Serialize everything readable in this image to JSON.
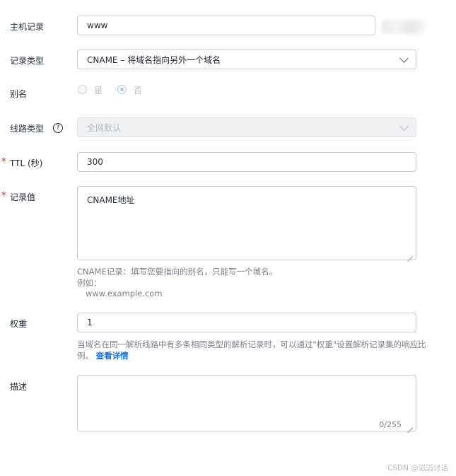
{
  "fields": {
    "host": {
      "label": "主机记录",
      "value": "www"
    },
    "record_type": {
      "label": "记录类型",
      "value": "CNAME – 将域名指向另外一个域名"
    },
    "alias": {
      "label": "别名",
      "options": [
        "是",
        "否"
      ],
      "selected": "否"
    },
    "line_type": {
      "label": "线路类型",
      "help": "?",
      "value": "全网默认"
    },
    "ttl": {
      "required_mark": "*",
      "label": "TTL (秒)",
      "value": "300"
    },
    "record_value": {
      "required_mark": "*",
      "label": "记录值",
      "value": "CNAME地址",
      "hint_line1": "CNAME记录：填写您要指向的别名，只能写一个域名。",
      "hint_line2": "例如：",
      "hint_line3": "www.example.com"
    },
    "weight": {
      "label": "权重",
      "value": "1",
      "hint_line1": "当域名在同一解析线路中有多条相同类型的解析记录时，可以通过\"权重\"设置解析记录集的响应比",
      "hint_line2": "例。",
      "link": "查看详情"
    },
    "description": {
      "label": "描述",
      "value": "",
      "counter": "0/255"
    }
  },
  "watermark": "CSDN @滔滔讨话",
  "colors": {
    "accent": "#1b74d8",
    "required": "#e0361c",
    "border": "#c7cbd4"
  }
}
